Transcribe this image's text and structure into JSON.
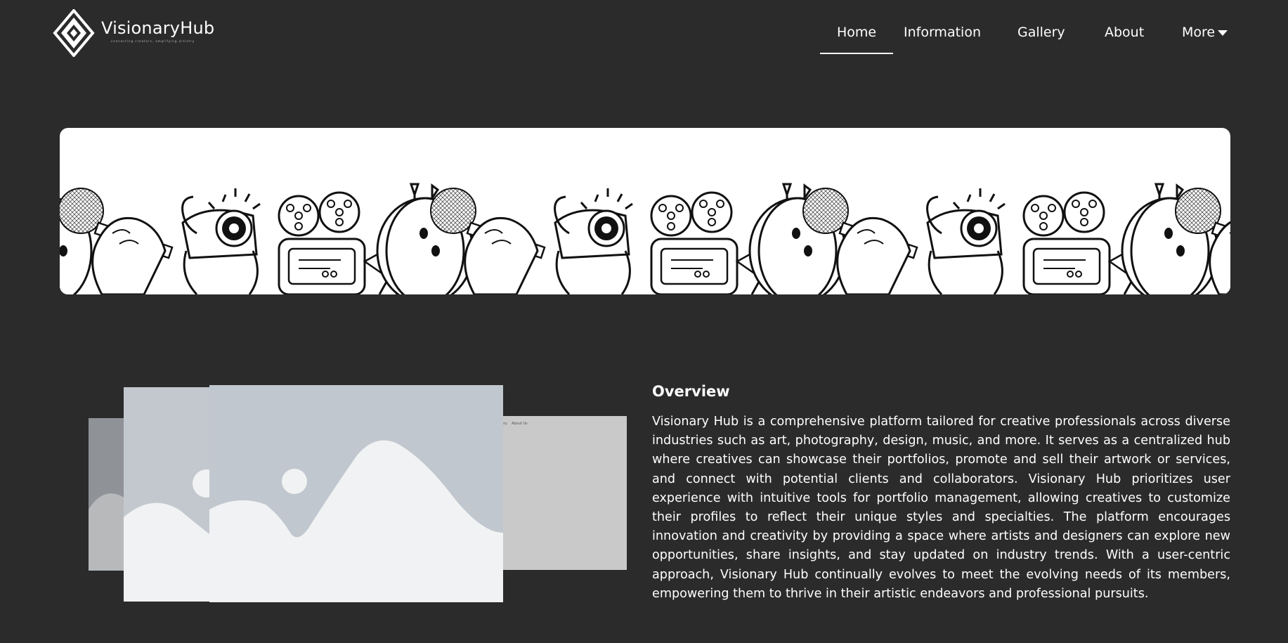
{
  "brand": {
    "name": "VisionaryHub",
    "tagline": "connecting creators, amplifying artistry"
  },
  "nav": {
    "items": [
      {
        "label": "Home",
        "active": true
      },
      {
        "label": "Information"
      },
      {
        "label": "Gallery"
      },
      {
        "label": "About"
      },
      {
        "label": "More"
      }
    ]
  },
  "banner": {
    "description_icons": [
      "microphone-icon",
      "camera-icon",
      "film-projector-icon",
      "paint-palette-icon"
    ]
  },
  "gallery_preview": {
    "back_labels": [
      "Gallery",
      "About Us"
    ]
  },
  "overview": {
    "title": "Overview",
    "body": "Visionary Hub is a comprehensive platform tailored for creative professionals across diverse industries such as art, photography, design, music, and more. It serves as a centralized hub where creatives can showcase their portfolios, promote and sell their artwork or services, and connect with potential clients and collaborators. Visionary Hub prioritizes user experience with intuitive tools for portfolio management, allowing creatives to customize their profiles to reflect their unique styles and specialties. The platform encourages innovation and creativity by providing a space where artists and designers can explore new opportunities, share insights, and stay updated on industry trends. With a user-centric approach, Visionary Hub continually evolves to meet the evolving needs of its members, empowering them to thrive in their artistic endeavors and professional pursuits."
  },
  "colors": {
    "background": "#2b2b2b",
    "text": "#ffffff",
    "banner_bg": "#ffffff",
    "placeholder_sky": "#c0c7ce",
    "placeholder_ground": "#f1f2f3"
  }
}
